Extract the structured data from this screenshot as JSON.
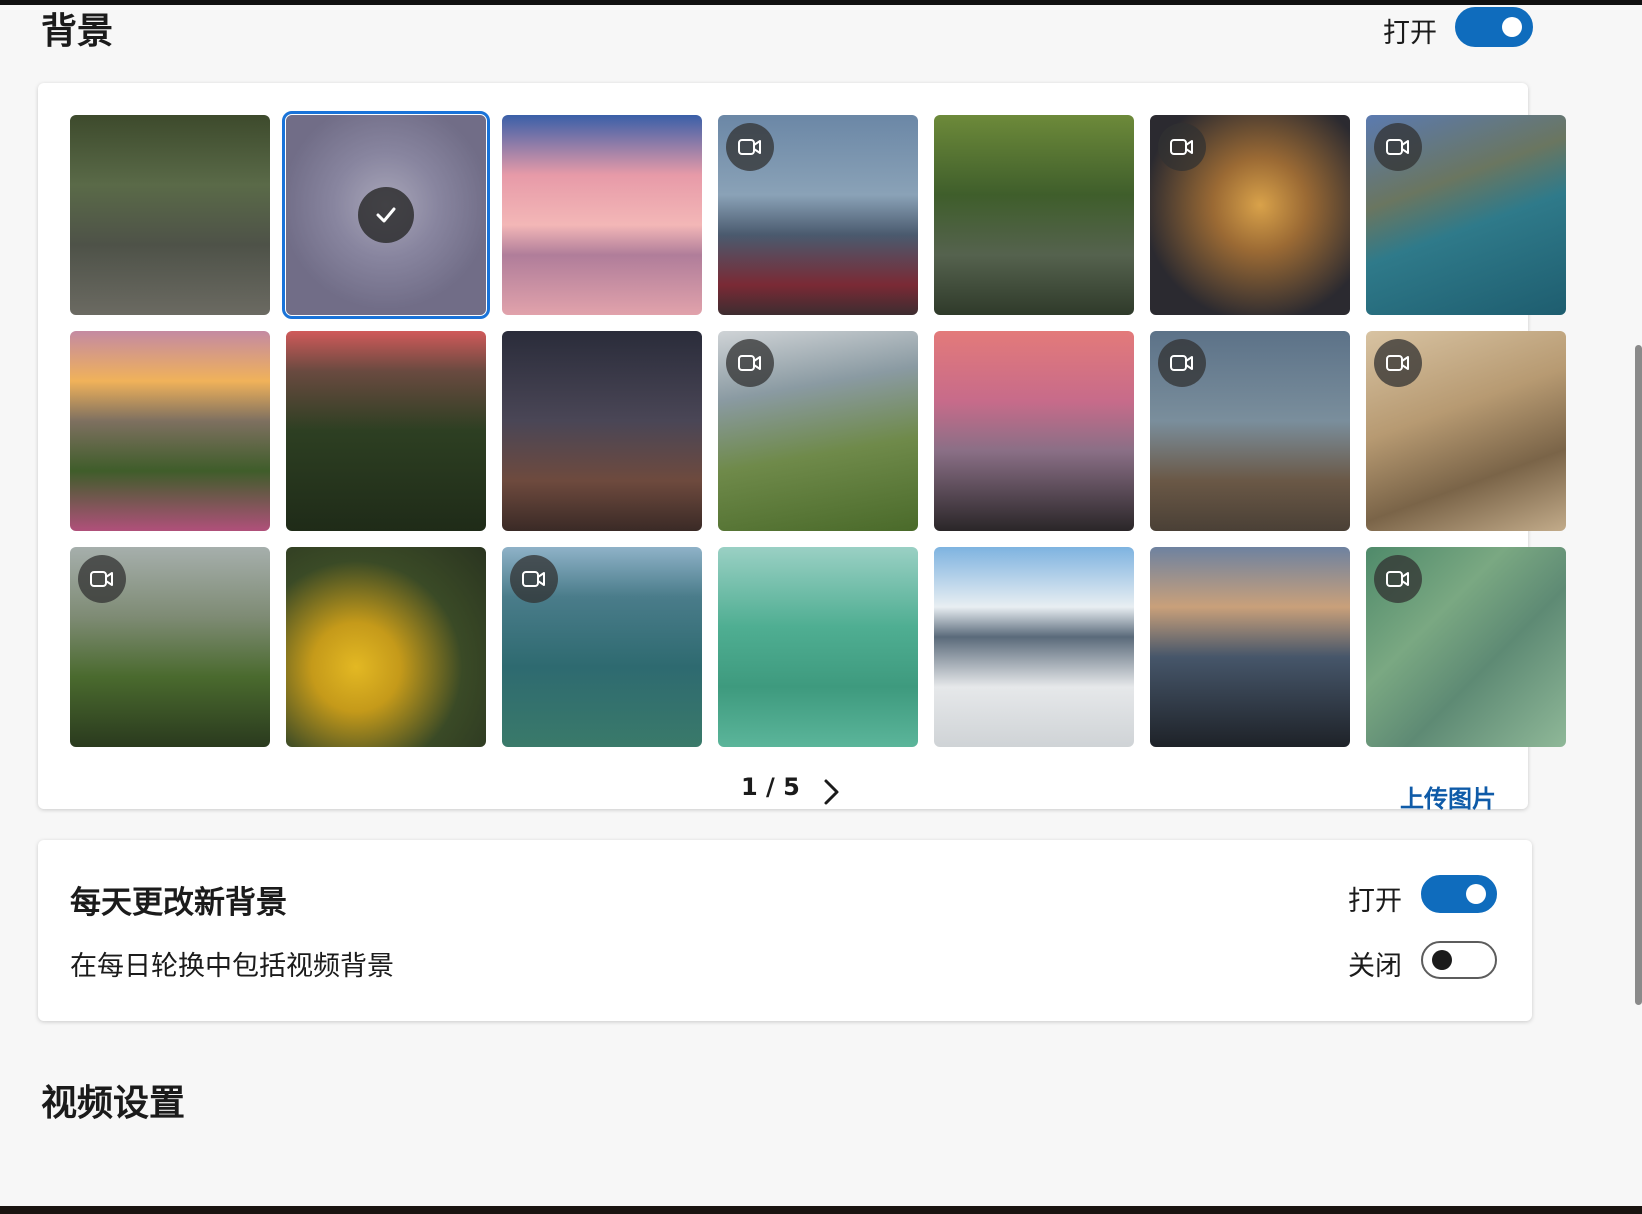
{
  "background": {
    "title": "背景",
    "toggle_label": "打开",
    "enabled": true
  },
  "gallery": {
    "thumbnails": [
      {
        "name": "temple-ruins",
        "video": false,
        "selected": false
      },
      {
        "name": "moonlit-sky",
        "video": false,
        "selected": true
      },
      {
        "name": "pink-cloud-reflection",
        "video": false,
        "selected": false
      },
      {
        "name": "mount-fuji-pagoda",
        "video": true,
        "selected": false
      },
      {
        "name": "forest-stream",
        "video": false,
        "selected": false
      },
      {
        "name": "coral-reef",
        "video": true,
        "selected": false
      },
      {
        "name": "mountain-lake",
        "video": true,
        "selected": false
      },
      {
        "name": "flower-hillside-sunset",
        "video": false,
        "selected": false
      },
      {
        "name": "jungle-waterfall",
        "video": false,
        "selected": false
      },
      {
        "name": "milky-way-rocks",
        "video": false,
        "selected": false
      },
      {
        "name": "green-alpine-ridge",
        "video": true,
        "selected": false
      },
      {
        "name": "red-sky-seascape",
        "video": false,
        "selected": false
      },
      {
        "name": "mountain-valley",
        "video": true,
        "selected": false
      },
      {
        "name": "desert-dunes-camels",
        "video": true,
        "selected": false
      },
      {
        "name": "misty-green-hills",
        "video": true,
        "selected": false
      },
      {
        "name": "sunflowers-bird",
        "video": false,
        "selected": false
      },
      {
        "name": "ocean-waves-aerial",
        "video": true,
        "selected": false
      },
      {
        "name": "surfers-turquoise-water",
        "video": false,
        "selected": false
      },
      {
        "name": "snowy-peaks",
        "video": false,
        "selected": false
      },
      {
        "name": "dark-mountains-sunrise",
        "video": false,
        "selected": false
      },
      {
        "name": "river-delta-aerial",
        "video": true,
        "selected": false
      }
    ],
    "page_indicator": "1 / 5",
    "upload_label": "上传图片"
  },
  "daily": {
    "title": "每天更改新背景",
    "toggle_label": "打开",
    "enabled": true,
    "video_label": "在每日轮换中包括视频背景",
    "video_toggle_label": "关闭",
    "video_enabled": false
  },
  "video_settings": {
    "title": "视频设置"
  },
  "colors": {
    "accent": "#0f6cbd",
    "link": "#0f5ba8",
    "selection": "#1a73d8"
  }
}
